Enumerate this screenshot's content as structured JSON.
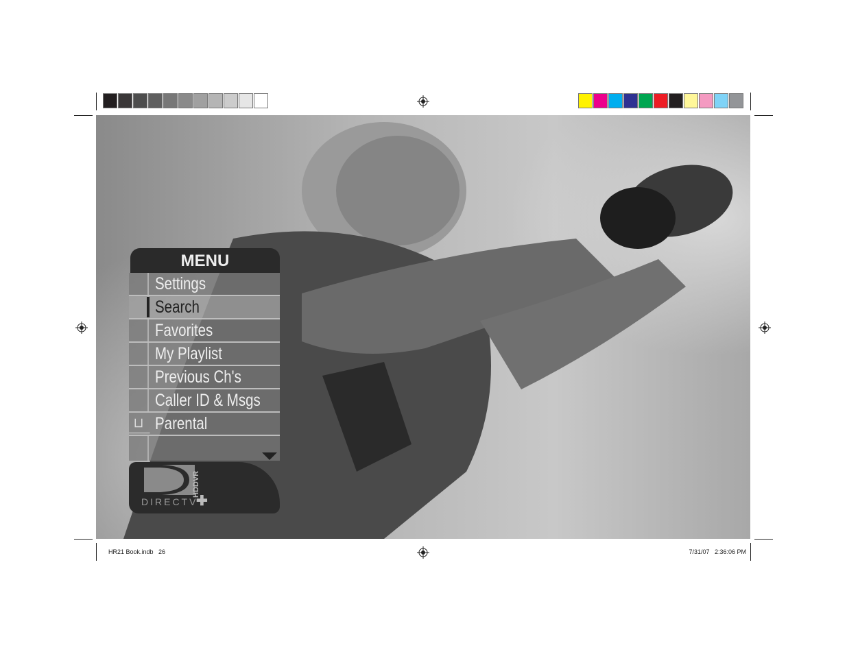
{
  "print_marks": {
    "grayscale_swatches": [
      "#231f20",
      "#3a3738",
      "#4d4d4d",
      "#5f5f5f",
      "#777777",
      "#8a8a8a",
      "#a0a0a0",
      "#b5b5b5",
      "#cccccc",
      "#e6e6e6",
      "#ffffff"
    ],
    "color_swatches": [
      "#fff200",
      "#ec008c",
      "#00aeef",
      "#2e3192",
      "#00a651",
      "#ed1c24",
      "#231f20",
      "#fff799",
      "#f49ac1",
      "#7fd3f7",
      "#939598"
    ]
  },
  "menu": {
    "title": "MENU",
    "items": [
      {
        "label": "Settings",
        "selected": false,
        "icon": ""
      },
      {
        "label": "Search",
        "selected": true,
        "icon": ""
      },
      {
        "label": "Favorites",
        "selected": false,
        "icon": ""
      },
      {
        "label": "My Playlist",
        "selected": false,
        "icon": ""
      },
      {
        "label": "Previous Ch's",
        "selected": false,
        "icon": ""
      },
      {
        "label": "Caller ID & Msgs",
        "selected": false,
        "icon": ""
      },
      {
        "label": "Parental",
        "selected": false,
        "icon": "lock-icon"
      }
    ],
    "logo": {
      "brand": "DIRECTV",
      "product": "HDDVR"
    }
  },
  "footer": {
    "left": "HR21 Book.indb   26",
    "right": "7/31/07   2:36:06 PM"
  }
}
